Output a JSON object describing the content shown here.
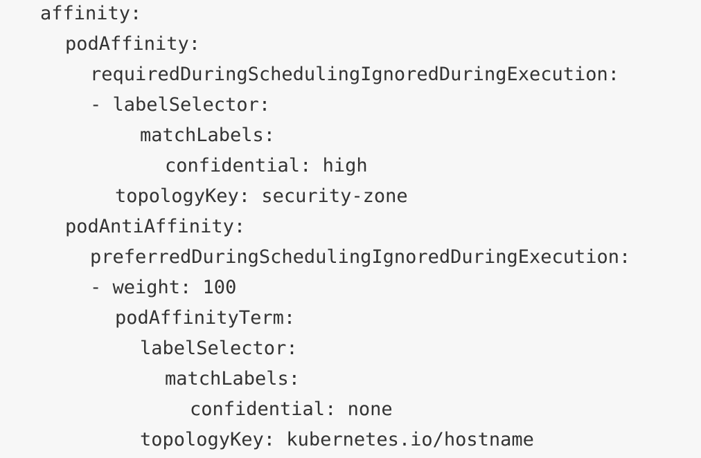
{
  "code": {
    "lines": [
      "affinity:",
      "podAffinity:",
      "requiredDuringSchedulingIgnoredDuringExecution:",
      "- labelSelector:",
      "matchLabels:",
      "confidential: high",
      "topologyKey: security-zone",
      "podAntiAffinity:",
      "preferredDuringSchedulingIgnoredDuringExecution:",
      "- weight: 100",
      "podAffinityTerm:",
      "labelSelector:",
      "matchLabels:",
      "confidential: none",
      "topologyKey: kubernetes.io/hostname"
    ]
  }
}
